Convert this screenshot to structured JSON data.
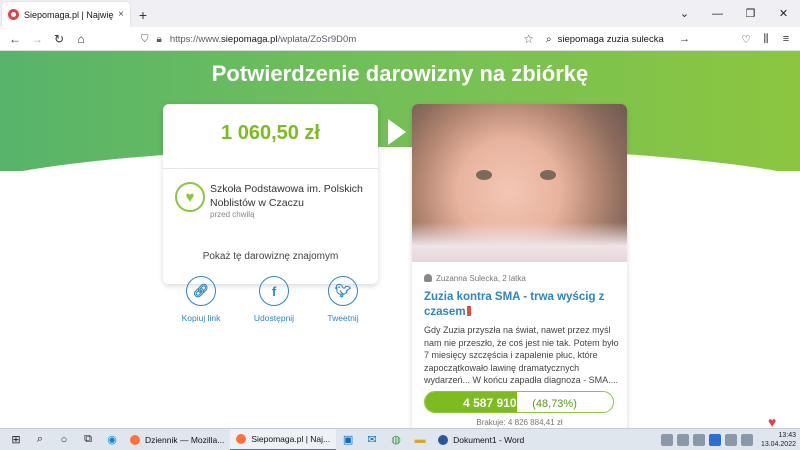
{
  "browser": {
    "tab_title": "Siepomaga.pl | Największy w P",
    "tab_close": "×",
    "new_tab": "+",
    "url_prefix": "https://www.",
    "url_domain": "siepomaga.pl",
    "url_path": "/wplata/ZoSr9D0m",
    "search_query": "siepomaga zuzia sulecka"
  },
  "page": {
    "title": "Potwierdzenie darowizny na zbiórkę",
    "donation_amount": "1 060,50 zł",
    "organization": "Szkoła Podstawowa im. Polskich Noblistów w Czaczu",
    "donation_time": "przed chwilą",
    "share_title": "Pokaż tę darowiznę znajomym",
    "share": {
      "copy_link": "Kopiuj link",
      "facebook": "Udostępnij",
      "twitter": "Tweetnij"
    }
  },
  "campaign": {
    "author": "Zuzanna Sulecka, 2 latka",
    "title": "Zuzia kontra SMA - trwa wyścig z czasem",
    "description": "Gdy Zuzia przyszła na świat, nawet przez myśl nam nie przeszło, że coś jest nie tak. Potem było 7 miesięcy szczęścia i zapalenie płuc, które zapoczątkowało lawinę dramatycznych wydarzeń... W końcu zapadła diagnoza - SMA....",
    "raised": "4 587 910 zł",
    "percent_label": "(48,73%)",
    "percent": 48.73,
    "missing": "Brakuje: 4 826 884,41 zł"
  },
  "taskbar": {
    "apps": [
      {
        "label": "Dziennik — Mozilla...",
        "color": "#ff7139",
        "active": false
      },
      {
        "label": "Siepomaga.pl | Naj...",
        "color": "#ff7139",
        "active": true
      },
      {
        "label": "Dokument1 - Word",
        "color": "#2b579a",
        "active": false
      }
    ],
    "time": "13:43",
    "date": "13.04.2022"
  },
  "colors": {
    "accent_green": "#7cbc1f",
    "link_blue": "#2d85c4"
  }
}
